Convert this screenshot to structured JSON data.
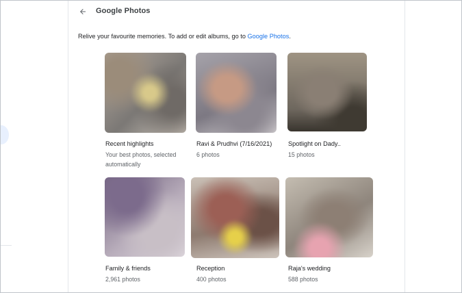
{
  "header": {
    "title": "Google Photos",
    "back_icon": "arrow-back-icon"
  },
  "intro": {
    "text": "Relive your favourite memories. To add or edit albums, go to ",
    "link": "Google Photos",
    "suffix": "."
  },
  "albums": [
    {
      "title": "Recent highlights",
      "subtitle_line1": "Your best photos, selected",
      "subtitle_line2": "automatically"
    },
    {
      "title": "Ravi & Prudhvi (7/16/2021)",
      "subtitle_line1": "6 photos",
      "subtitle_line2": ""
    },
    {
      "title": "Spotlight on Dady..",
      "subtitle_line1": "15 photos",
      "subtitle_line2": ""
    },
    {
      "title": "Family & friends",
      "subtitle_line1": "2,961 photos",
      "subtitle_line2": ""
    },
    {
      "title": "Reception",
      "subtitle_line1": "400 photos",
      "subtitle_line2": ""
    },
    {
      "title": "Raja's wedding",
      "subtitle_line1": "588 photos",
      "subtitle_line2": ""
    }
  ],
  "colors": {
    "link": "#1a73e8",
    "text": "#202124",
    "secondary_text": "#5f6368"
  }
}
